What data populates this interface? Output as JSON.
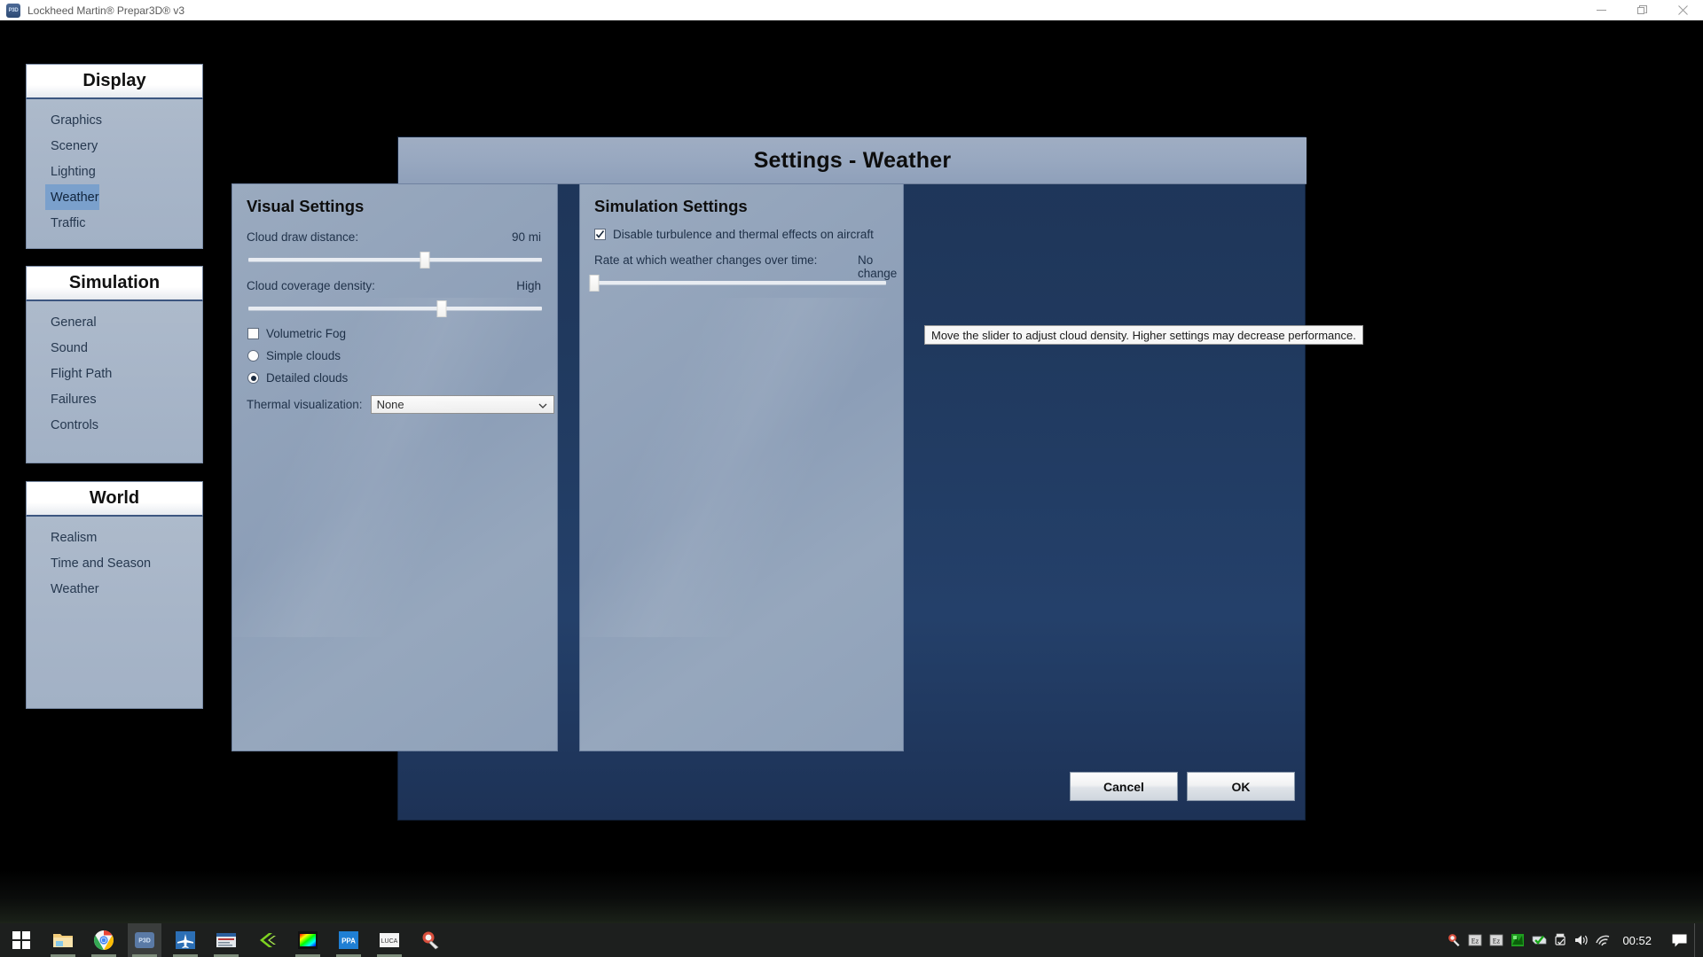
{
  "window": {
    "title": "Lockheed Martin® Prepar3D® v3",
    "app_icon": "p3d-icon",
    "minimize_label": "─",
    "restore_label": "❐",
    "close_label": "✕"
  },
  "dialog": {
    "title": "Settings - Weather"
  },
  "sidebar": {
    "groups": [
      {
        "header": "Display",
        "items": [
          {
            "label": "Graphics",
            "selected": false
          },
          {
            "label": "Scenery",
            "selected": false
          },
          {
            "label": "Lighting",
            "selected": false
          },
          {
            "label": "Weather",
            "selected": true
          },
          {
            "label": "Traffic",
            "selected": false
          }
        ]
      },
      {
        "header": "Simulation",
        "items": [
          {
            "label": "General",
            "selected": false
          },
          {
            "label": "Sound",
            "selected": false
          },
          {
            "label": "Flight Path",
            "selected": false
          },
          {
            "label": "Failures",
            "selected": false
          },
          {
            "label": "Controls",
            "selected": false
          }
        ]
      },
      {
        "header": "World",
        "items": [
          {
            "label": "Realism",
            "selected": false
          },
          {
            "label": "Time and Season",
            "selected": false
          },
          {
            "label": "Weather",
            "selected": false
          }
        ]
      }
    ]
  },
  "visual_settings": {
    "title": "Visual Settings",
    "cloud_draw_distance": {
      "label": "Cloud draw distance:",
      "value": "90 mi",
      "slider_percent": 60
    },
    "cloud_coverage_density": {
      "label": "Cloud coverage density:",
      "value": "High",
      "slider_percent": 66
    },
    "volumetric_fog": {
      "label": "Volumetric Fog",
      "checked": false
    },
    "cloud_detail": {
      "simple": {
        "label": "Simple clouds",
        "selected": false
      },
      "detailed": {
        "label": "Detailed clouds",
        "selected": true
      }
    },
    "thermal_visualization": {
      "label": "Thermal visualization:",
      "value": "None",
      "options": [
        "None"
      ],
      "chevron": "chevron-down-icon"
    }
  },
  "simulation_settings": {
    "title": "Simulation Settings",
    "disable_turbulence": {
      "label": "Disable turbulence and thermal effects on aircraft",
      "checked": true
    },
    "weather_change_rate": {
      "label": "Rate at which weather changes over time:",
      "value": "No change",
      "slider_percent": 0
    }
  },
  "tooltip": {
    "text": "Move the slider to adjust cloud density. Higher settings may decrease performance."
  },
  "buttons": {
    "cancel": "Cancel",
    "ok": "OK"
  },
  "taskbar": {
    "start": "windows-start-icon",
    "apps": [
      {
        "name": "file-explorer-icon",
        "running": true,
        "active": false
      },
      {
        "name": "google-chrome-icon",
        "running": true,
        "active": false
      },
      {
        "name": "prepar3d-icon",
        "running": true,
        "active": true
      },
      {
        "name": "flight-sim-icon",
        "running": true,
        "active": false
      },
      {
        "name": "editor-icon",
        "running": true,
        "active": false
      },
      {
        "name": "green-arrow-icon",
        "running": false,
        "active": false
      },
      {
        "name": "color-palette-icon",
        "running": true,
        "active": false
      },
      {
        "name": "ppa-app-icon",
        "running": true,
        "active": false
      },
      {
        "name": "luca-app-icon",
        "running": true,
        "active": false
      },
      {
        "name": "ccleaner-icon",
        "running": false,
        "active": false
      }
    ],
    "tray": [
      {
        "name": "ccleaner-tray-icon"
      },
      {
        "name": "ez-tray-icon-1",
        "label": "Ez"
      },
      {
        "name": "ez-tray-icon-2",
        "label": "Ez"
      },
      {
        "name": "network-adapter-tray-icon"
      },
      {
        "name": "antivirus-shield-tray-icon"
      },
      {
        "name": "usb-eject-tray-icon"
      },
      {
        "name": "volume-tray-icon"
      },
      {
        "name": "wifi-tray-icon"
      }
    ],
    "clock": "00:52",
    "action_center": "action-center-icon"
  },
  "colors": {
    "accent": "#7aa0cc",
    "dialog_bg": "#24406a",
    "panel_bg": "#93a4bb",
    "header_bg": "#98a8c0",
    "taskbar": "#1d1f1e"
  }
}
